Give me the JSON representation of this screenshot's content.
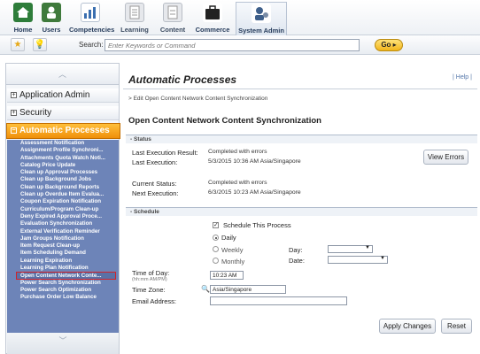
{
  "nav": {
    "items": [
      {
        "label": "Home",
        "icon": "home-icon",
        "color": "#2e7d3a"
      },
      {
        "label": "Users",
        "icon": "users-icon",
        "color": "#3f7a3c"
      },
      {
        "label": "Competencies",
        "icon": "competencies-icon",
        "color": "#3a6fb0"
      },
      {
        "label": "Learning",
        "icon": "learning-icon",
        "color": "#8a8f98"
      },
      {
        "label": "Content",
        "icon": "content-icon",
        "color": "#8a8f98"
      },
      {
        "label": "Commerce",
        "icon": "commerce-icon",
        "color": "#222222"
      },
      {
        "label": "System Admin",
        "icon": "system-admin-icon",
        "color": "#3e5f8a"
      }
    ],
    "active": "System Admin"
  },
  "search": {
    "label": "Search:",
    "placeholder": "Enter Keywords or Command",
    "go_label": "Go ▸"
  },
  "sidebar": {
    "sections": [
      "Application Admin",
      "Security"
    ],
    "expanded": "Automatic Processes",
    "items": [
      "Assessment Notification",
      "Assignment Profile Synchroni...",
      "Attachments Quota Watch Noti...",
      "Catalog Price Update",
      "Clean up Approval Processes",
      "Clean up Background Jobs",
      "Clean up Background Reports",
      "Clean up Overdue Item Evalua...",
      "Coupon Expiration Notification",
      "Curriculum/Program Clean-up",
      "Deny Expired Approval Proce...",
      "Evaluation Synchronization",
      "External Verification Reminder",
      "Jam Groups Notification",
      "Item Request Clean-up",
      "Item Scheduling Demand",
      "Learning Expiration",
      "Learning Plan Notification",
      "Open Content Network Conte...",
      "Power Search Synchronization",
      "Power Search Optimization",
      "Purchase Order Low Balance"
    ],
    "selected_index": 18,
    "accent": "#f29a12",
    "list_color": "#6d84b8"
  },
  "main": {
    "title": "Automatic Processes",
    "help": "| Help |",
    "breadcrumb": "> Edit Open Content Network Content Synchronization",
    "section_title": "Open Content Network Content Synchronization",
    "status": {
      "header": "Status",
      "last_result_label": "Last Execution Result:",
      "last_result_value": "Completed with errors",
      "last_exec_label": "Last Execution:",
      "last_exec_value": "5/3/2015 10:36 AM Asia/Singapore",
      "view_errors": "View Errors",
      "current_status_label": "Current Status:",
      "current_status_value": "Completed with errors",
      "next_exec_label": "Next Execution:",
      "next_exec_value": "6/3/2015 10:23 AM Asia/Singapore"
    },
    "schedule": {
      "header": "Schedule",
      "schedule_this": "Schedule This Process",
      "daily": "Daily",
      "weekly": "Weekly",
      "monthly": "Monthly",
      "selected": "Daily",
      "day_label": "Day:",
      "date_label": "Date:",
      "time_label": "Time of Day:",
      "time_hint": "(hh:mm AM/PM)",
      "time_value": "10:23 AM",
      "tz_label": "Time Zone:",
      "tz_value": "Asia/Singapore",
      "email_label": "Email Address:",
      "email_value": ""
    },
    "apply": "Apply Changes",
    "reset": "Reset"
  }
}
